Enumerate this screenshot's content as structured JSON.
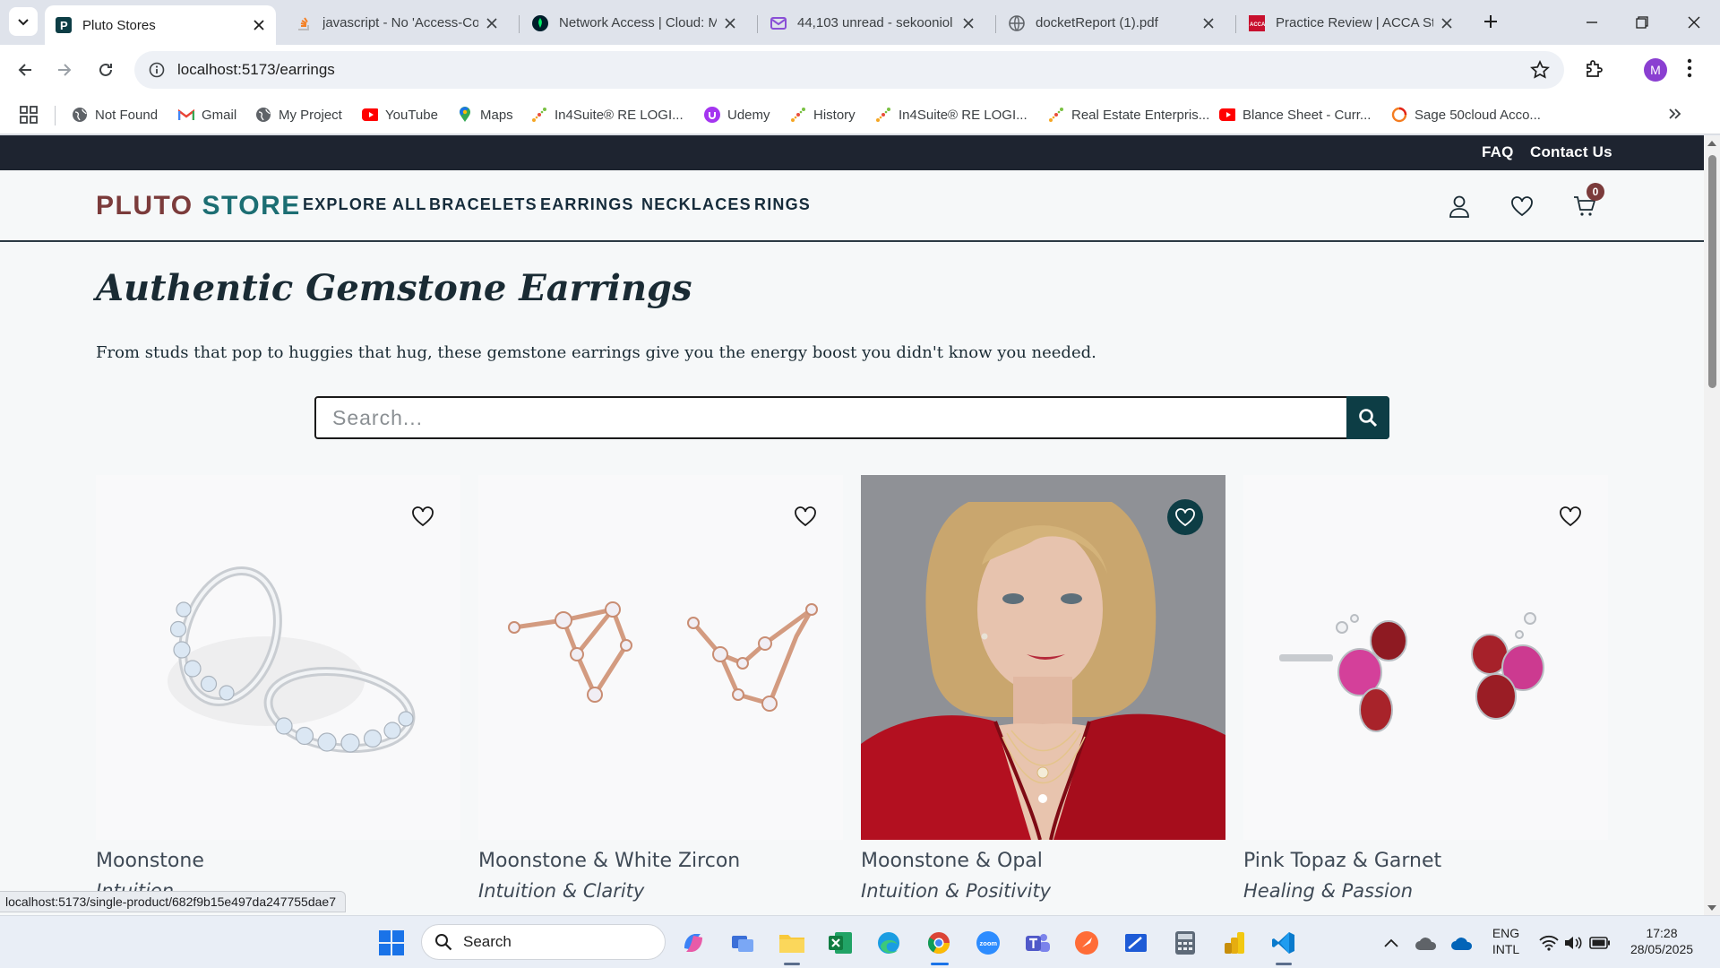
{
  "browser": {
    "tabs": [
      {
        "title": "Pluto Stores",
        "active": true,
        "icon": "pluto-favicon"
      },
      {
        "title": "javascript - No 'Access-Con",
        "icon": "stackoverflow-favicon"
      },
      {
        "title": "Network Access | Cloud: M",
        "icon": "mongodb-favicon"
      },
      {
        "title": "44,103 unread - sekooniol",
        "icon": "mail-favicon"
      },
      {
        "title": "docketReport (1).pdf",
        "icon": "globe-favicon"
      },
      {
        "title": "Practice Review | ACCA Stu",
        "icon": "acca-favicon"
      }
    ],
    "url": "localhost:5173/earrings",
    "profile_initial": "M",
    "bookmarks": [
      {
        "label": "Not Found",
        "icon": "globe-icon"
      },
      {
        "label": "Gmail",
        "icon": "gmail-icon"
      },
      {
        "label": "My Project",
        "icon": "globe-icon"
      },
      {
        "label": "YouTube",
        "icon": "youtube-icon"
      },
      {
        "label": "Maps",
        "icon": "maps-icon"
      },
      {
        "label": "In4Suite® RE LOGI...",
        "icon": "in4suite-icon"
      },
      {
        "label": "Udemy",
        "icon": "udemy-icon"
      },
      {
        "label": "History",
        "icon": "in4suite-icon"
      },
      {
        "label": "In4Suite® RE LOGI...",
        "icon": "in4suite-icon"
      },
      {
        "label": "Real Estate Enterpris...",
        "icon": "in4suite-icon"
      },
      {
        "label": "Blance Sheet - Curr...",
        "icon": "youtube-icon"
      },
      {
        "label": "Sage 50cloud Acco...",
        "icon": "sage-icon"
      }
    ],
    "status_url": "localhost:5173/single-product/682f9b15e497da247755dae7"
  },
  "site": {
    "top_links": {
      "faq": "FAQ",
      "contact": "Contact Us"
    },
    "logo": {
      "part1": "PLUTO",
      "part2": "STORE"
    },
    "nav": [
      "EXPLORE ALL",
      "BRACELETS",
      "EARRINGS",
      "NECKLACES",
      "RINGS"
    ],
    "cart_count": "0",
    "colors": {
      "accent": "#0d3d45",
      "logo_pluto": "#7b3b3b",
      "logo_store": "#1c6e73",
      "topbar": "#1e2430"
    }
  },
  "page": {
    "title": "Authentic Gemstone Earrings",
    "subtitle": "From studs that pop to huggies that hug, these gemstone earrings give you the energy boost you didn't know you needed.",
    "search_placeholder": "Search..."
  },
  "products": [
    {
      "name": "Moonstone",
      "sub": "Intuition",
      "wishlisted": false,
      "image": "moonstone-huggie-hoops"
    },
    {
      "name": "Moonstone & White Zircon",
      "sub": "Intuition & Clarity",
      "wishlisted": false,
      "image": "constellation-earrings-rose-gold"
    },
    {
      "name": "Moonstone & Opal",
      "sub": "Intuition & Positivity",
      "wishlisted": true,
      "image": "model-red-scarf-necklaces"
    },
    {
      "name": "Pink Topaz & Garnet",
      "sub": "Healing & Passion",
      "wishlisted": false,
      "image": "pink-topaz-garnet-studs"
    }
  ],
  "taskbar": {
    "search_label": "Search",
    "lang": "ENG",
    "layout": "INTL",
    "time": "17:28",
    "date": "28/05/2025"
  }
}
